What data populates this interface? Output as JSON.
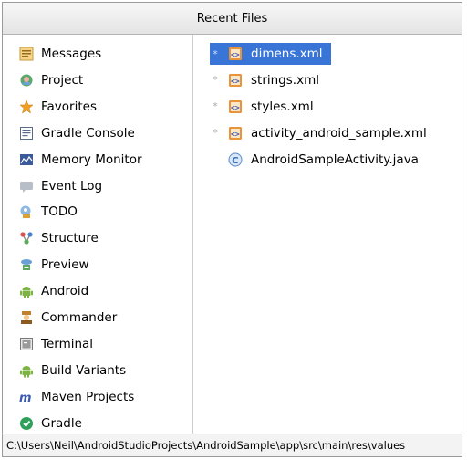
{
  "popup": {
    "title": "Recent Files",
    "tool_windows": [
      {
        "label": "Messages",
        "icon": "messages-icon"
      },
      {
        "label": "Project",
        "icon": "project-icon"
      },
      {
        "label": "Favorites",
        "icon": "star-icon"
      },
      {
        "label": "Gradle Console",
        "icon": "console-icon"
      },
      {
        "label": "Memory Monitor",
        "icon": "memory-monitor-icon"
      },
      {
        "label": "Event Log",
        "icon": "event-log-icon"
      },
      {
        "label": "TODO",
        "icon": "todo-icon"
      },
      {
        "label": "Structure",
        "icon": "structure-icon"
      },
      {
        "label": "Preview",
        "icon": "preview-icon"
      },
      {
        "label": "Android",
        "icon": "android-icon"
      },
      {
        "label": "Commander",
        "icon": "commander-icon"
      },
      {
        "label": "Terminal",
        "icon": "terminal-icon"
      },
      {
        "label": "Build Variants",
        "icon": "android-icon"
      },
      {
        "label": "Maven Projects",
        "icon": "maven-icon"
      },
      {
        "label": "Gradle",
        "icon": "gradle-icon"
      }
    ],
    "recent_files": [
      {
        "label": "dimens.xml",
        "icon": "xml-file-icon",
        "starred": true,
        "selected": true
      },
      {
        "label": "strings.xml",
        "icon": "xml-file-icon",
        "starred": true,
        "selected": false
      },
      {
        "label": "styles.xml",
        "icon": "xml-file-icon",
        "starred": true,
        "selected": false
      },
      {
        "label": "activity_android_sample.xml",
        "icon": "xml-file-icon",
        "starred": true,
        "selected": false
      },
      {
        "label": "AndroidSampleActivity.java",
        "icon": "java-class-icon",
        "starred": false,
        "selected": false
      }
    ],
    "status_path": "C:\\Users\\Neil\\AndroidStudioProjects\\AndroidSample\\app\\src\\main\\res\\values",
    "star_glyph": "*",
    "colors": {
      "selection": "#3875d7"
    }
  }
}
